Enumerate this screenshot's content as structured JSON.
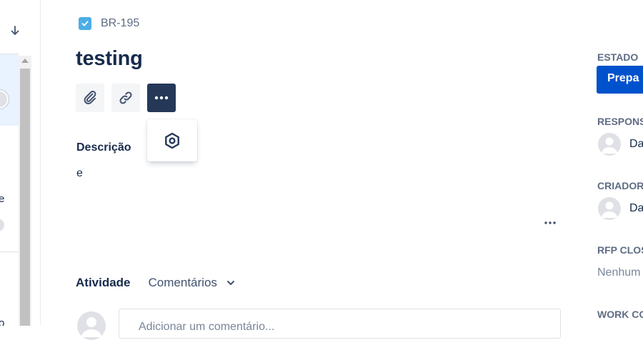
{
  "issue": {
    "key": "BR-195",
    "title": "testing",
    "type_icon": "checkbox-icon"
  },
  "toolbar": {
    "attach_icon": "paperclip-icon",
    "link_icon": "link-icon",
    "more_icon": "more-horizontal-icon"
  },
  "dropdown": {
    "item_icon": "hexagon-settings-icon"
  },
  "description": {
    "label": "Descrição",
    "body": "e"
  },
  "activity": {
    "label": "Atividade",
    "filter": "Comentários",
    "comment_placeholder": "Adicionar um comentário..."
  },
  "sidebar_fields": {
    "status_label": "ESTADO",
    "status_value": "Prepa",
    "assignee_label": "RESPONSÁ",
    "assignee_name": "Da",
    "reporter_label": "CRIADOR",
    "reporter_name": "Da",
    "rfp_label": "RFP CLOS",
    "rfp_value": "Nenhum",
    "work_label": "WORK CO"
  },
  "left_panel": {
    "sort_icon": "arrow-down-icon",
    "cut_letter_1": "e",
    "cut_letter_2": "o"
  },
  "colors": {
    "primary": "#0052cc",
    "dark_button": "#253858",
    "text": "#172b4d",
    "muted": "#5e6c84",
    "issue_type": "#4bade8"
  }
}
